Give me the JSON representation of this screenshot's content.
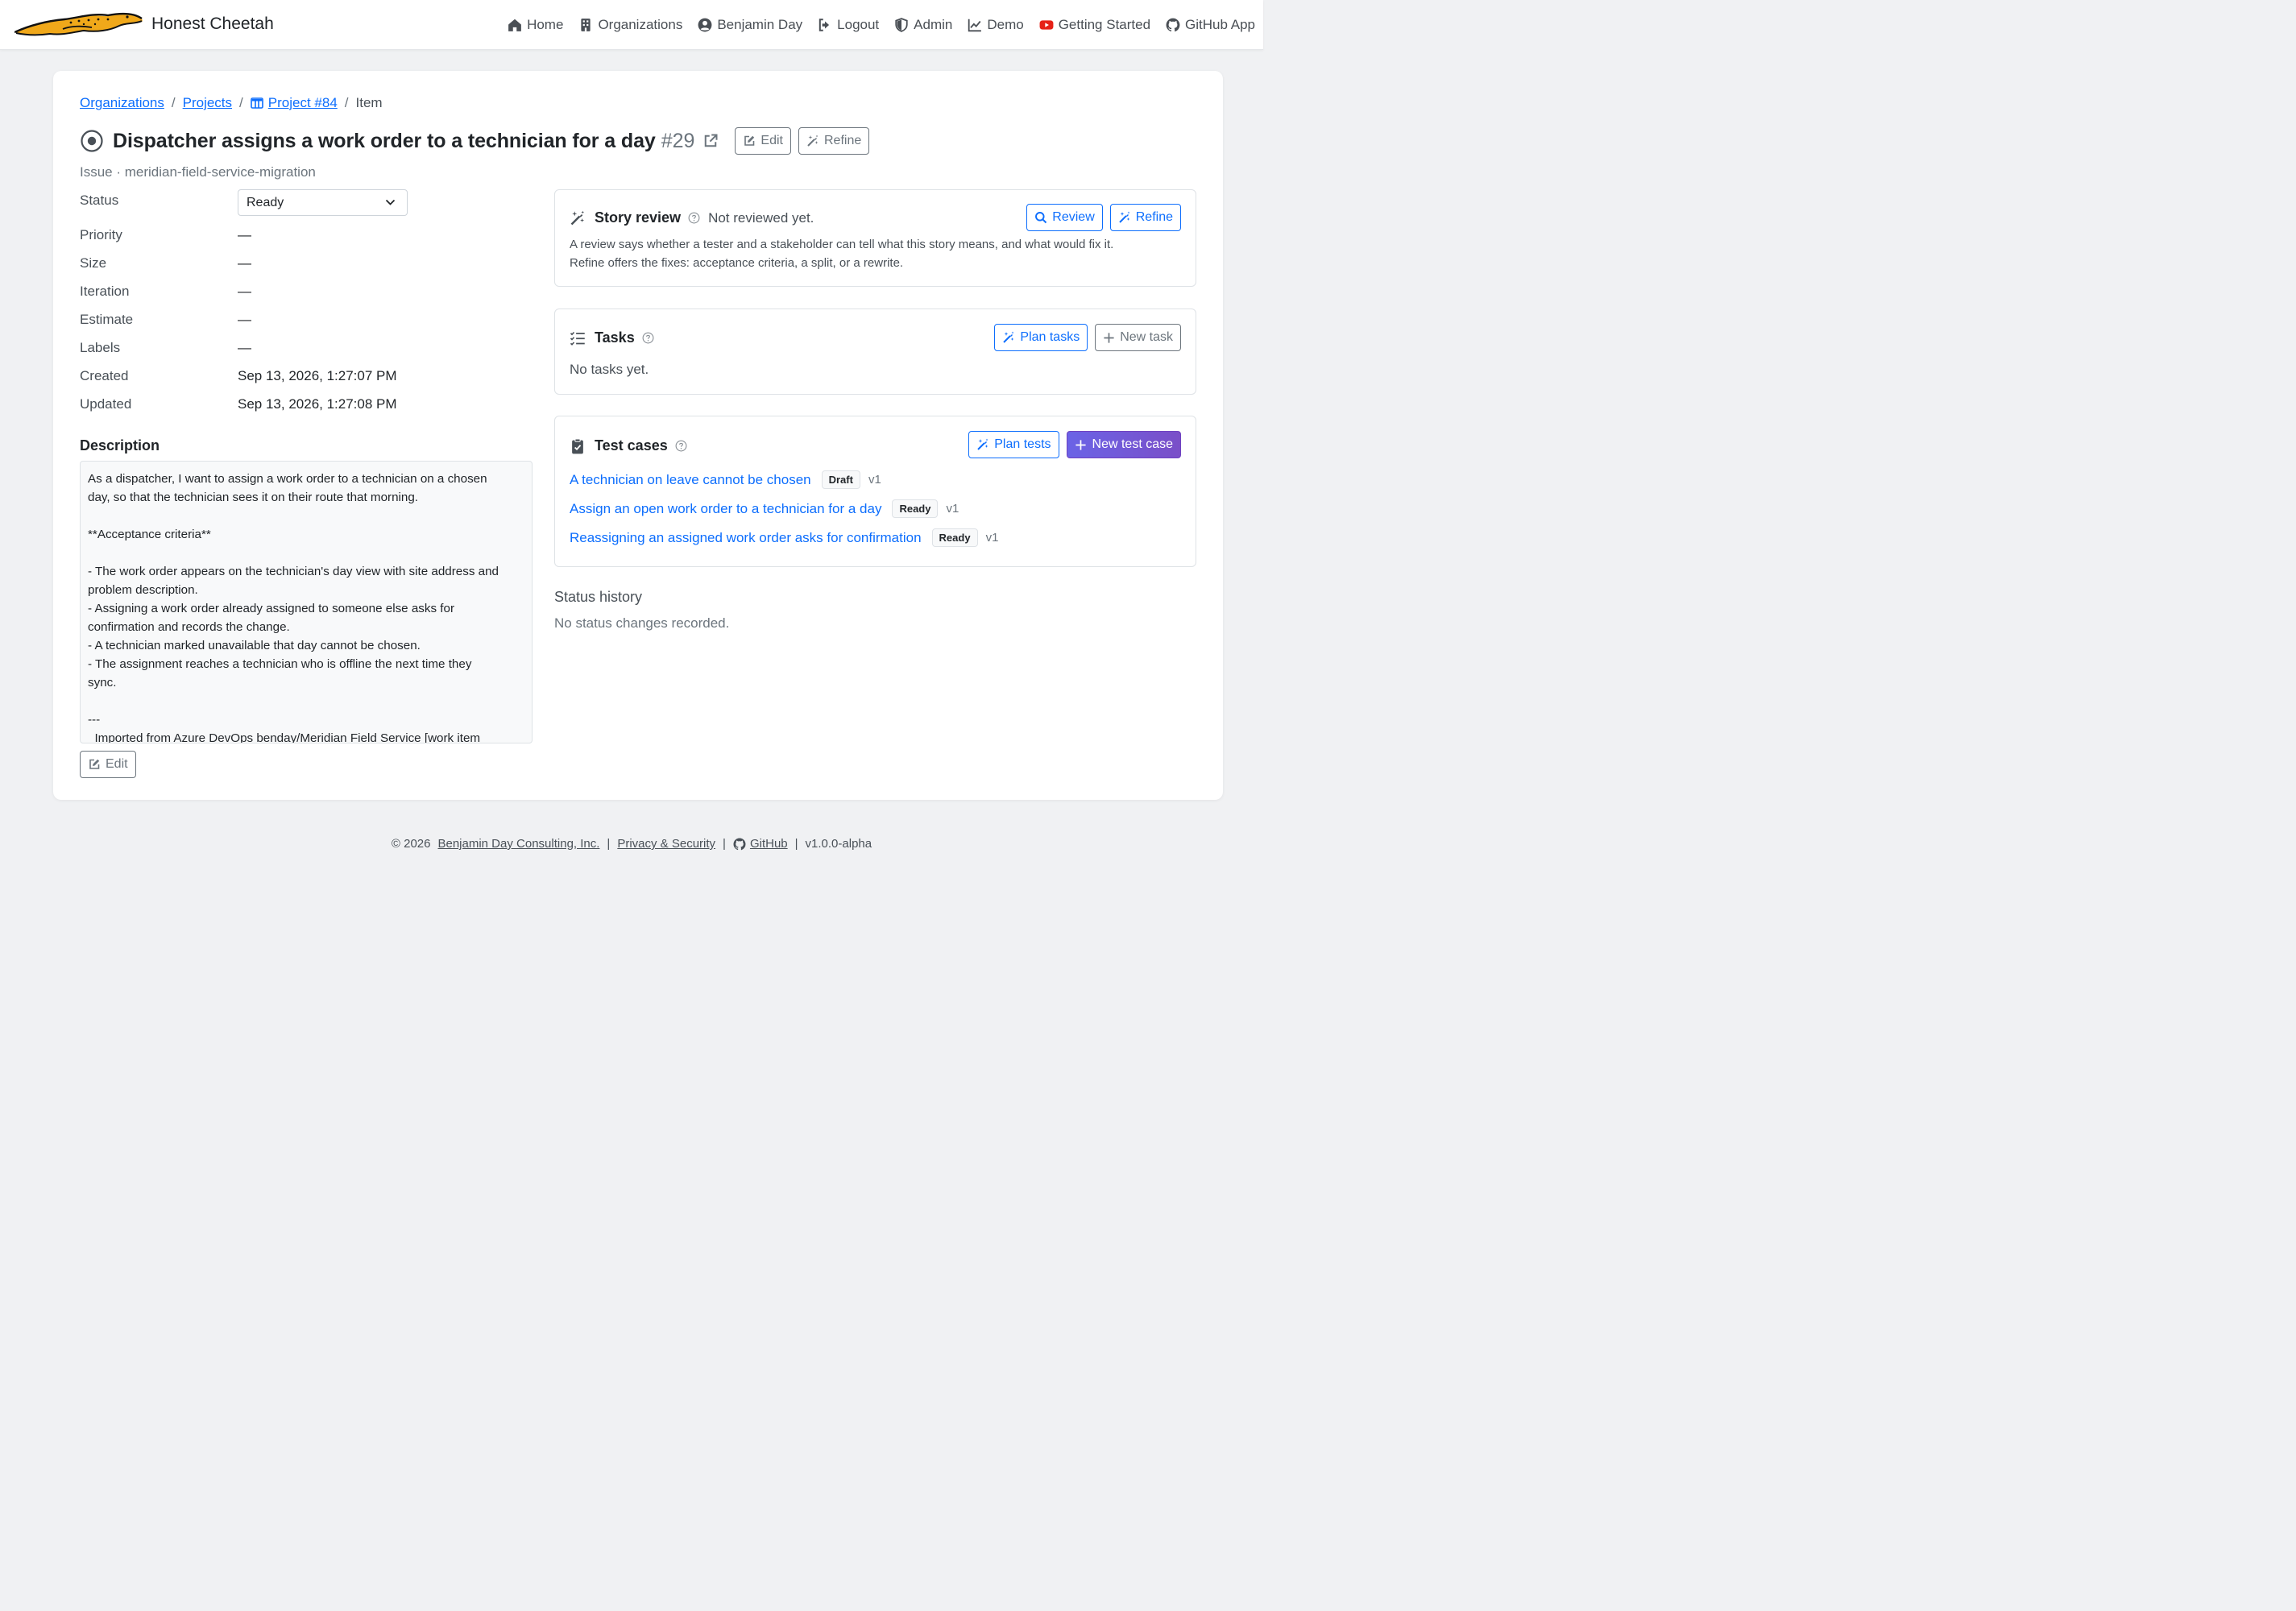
{
  "app": {
    "name": "Honest Cheetah"
  },
  "nav": {
    "items": [
      {
        "label": "Home",
        "icon": "home-icon"
      },
      {
        "label": "Organizations",
        "icon": "building-icon"
      },
      {
        "label": "Benjamin Day",
        "icon": "user-circle-icon"
      },
      {
        "label": "Logout",
        "icon": "logout-icon"
      },
      {
        "label": "Admin",
        "icon": "shield-icon"
      },
      {
        "label": "Demo",
        "icon": "chart-line-icon"
      },
      {
        "label": "Getting Started",
        "icon": "youtube-icon"
      },
      {
        "label": "GitHub App",
        "icon": "github-icon"
      }
    ]
  },
  "breadcrumb": {
    "organizations": "Organizations",
    "projects": "Projects",
    "project": "Project #84",
    "current": "Item",
    "separator": "/"
  },
  "item": {
    "title": "Dispatcher assigns a work order to a technician for a day",
    "number": "#29",
    "edit_label": "Edit",
    "refine_label": "Refine",
    "subtitle": "Issue · meridian-field-service-migration"
  },
  "props": {
    "status_label": "Status",
    "status_value": "Ready",
    "priority_label": "Priority",
    "priority_value": "—",
    "size_label": "Size",
    "size_value": "—",
    "iteration_label": "Iteration",
    "iteration_value": "—",
    "estimate_label": "Estimate",
    "estimate_value": "—",
    "labels_label": "Labels",
    "labels_value": "—",
    "created_label": "Created",
    "created_value": "Sep 13, 2026, 1:27:07 PM",
    "updated_label": "Updated",
    "updated_value": "Sep 13, 2026, 1:27:08 PM"
  },
  "description": {
    "heading": "Description",
    "body": "As a dispatcher, I want to assign a work order to a technician on a chosen\nday, so that the technician sees it on their route that morning.\n\n**Acceptance criteria**\n\n- The work order appears on the technician's day view with site address and\nproblem description.\n- Assigning a work order already assigned to someone else asks for\nconfirmation and records the change.\n- A technician marked unavailable that day cannot be chosen.\n- The assignment reaches a technician who is offline the next time they\nsync.\n\n---\n  Imported from Azure DevOps benday/Meridian Field Service [work item",
    "edit_label": "Edit"
  },
  "story_review": {
    "title": "Story review",
    "status": "Not reviewed yet.",
    "review_label": "Review",
    "refine_label": "Refine",
    "line1": "A review says whether a tester and a stakeholder can tell what this story means, and what would fix it.",
    "line2": "Refine offers the fixes: acceptance criteria, a split, or a rewrite."
  },
  "tasks": {
    "title": "Tasks",
    "plan_label": "Plan tasks",
    "new_label": "New task",
    "empty": "No tasks yet."
  },
  "test_cases": {
    "title": "Test cases",
    "plan_label": "Plan tests",
    "new_label": "New test case",
    "items": [
      {
        "name": "A technician on leave cannot be chosen",
        "status": "Draft",
        "version": "v1"
      },
      {
        "name": "Assign an open work order to a technician for a day",
        "status": "Ready",
        "version": "v1"
      },
      {
        "name": "Reassigning an assigned work order asks for confirmation",
        "status": "Ready",
        "version": "v1"
      }
    ]
  },
  "history": {
    "title": "Status history",
    "empty": "No status changes recorded."
  },
  "footer": {
    "copyright": "© 2026",
    "company": "Benjamin Day Consulting, Inc.",
    "privacy": "Privacy & Security",
    "github": "GitHub",
    "version": "v1.0.0-alpha",
    "sep": "|"
  },
  "colors": {
    "link": "#0d6efd",
    "primary_gradient_start": "#6b63e6",
    "primary_gradient_end": "#7a4fc8",
    "muted": "#6c757d",
    "background": "#f0f1f3"
  }
}
